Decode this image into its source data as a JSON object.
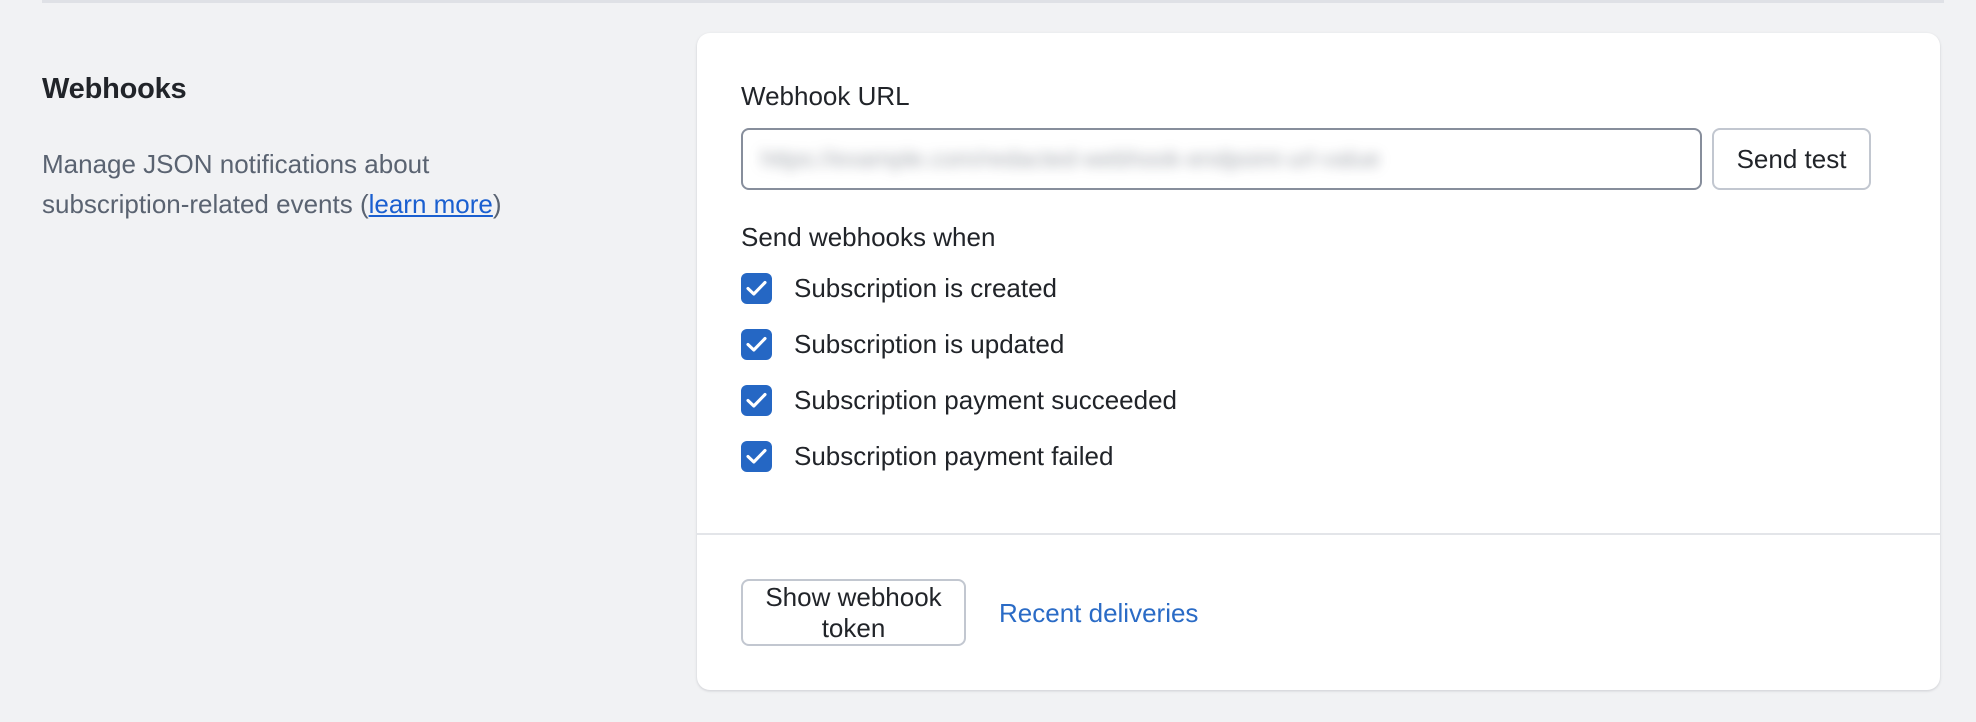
{
  "section": {
    "title": "Webhooks",
    "description_prefix": "Manage JSON notifications about subscription-related events (",
    "description_link": "learn more",
    "description_suffix": ")"
  },
  "card": {
    "url_field": {
      "label": "Webhook URL",
      "value": "https://example.com/redacted-webhook-endpoint-url-value",
      "redacted": true
    },
    "send_test_label": "Send test",
    "events_label": "Send webhooks when",
    "events": [
      {
        "label": "Subscription is created",
        "checked": true
      },
      {
        "label": "Subscription is updated",
        "checked": true
      },
      {
        "label": "Subscription payment succeeded",
        "checked": true
      },
      {
        "label": "Subscription payment failed",
        "checked": true
      }
    ],
    "footer": {
      "show_token_label": "Show webhook token",
      "recent_deliveries_label": "Recent deliveries"
    }
  },
  "colors": {
    "page_background": "#f1f2f4",
    "card_background": "#ffffff",
    "checkbox_accent": "#2567c4",
    "link": "#1a5fd0",
    "link_plain": "#2a6bc6",
    "text_primary": "#212429",
    "text_muted": "#5a6371",
    "divider": "#dfe1e6",
    "input_border": "#878e9c",
    "button_border": "#c2c7d0"
  },
  "icons": {
    "check": "check-icon"
  }
}
